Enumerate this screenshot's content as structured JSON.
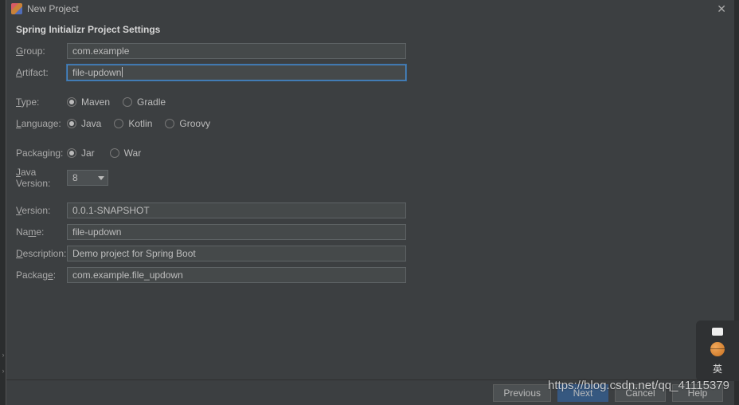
{
  "window": {
    "title": "New Project",
    "subtitle": "Spring Initializr Project Settings"
  },
  "fields": {
    "group": {
      "label": "Group:",
      "value": "com.example"
    },
    "artifact": {
      "label": "Artifact:",
      "value": "file-updown"
    },
    "type": {
      "label": "Type:",
      "options": [
        "Maven",
        "Gradle"
      ],
      "selected": "Maven"
    },
    "language": {
      "label": "Language:",
      "options": [
        "Java",
        "Kotlin",
        "Groovy"
      ],
      "selected": "Java"
    },
    "packaging": {
      "label": "Packaging:",
      "options": [
        "Jar",
        "War"
      ],
      "selected": "Jar"
    },
    "java_version": {
      "label": "Java Version:",
      "value": "8"
    },
    "version": {
      "label": "Version:",
      "value": "0.0.1-SNAPSHOT"
    },
    "name": {
      "label": "Name:",
      "value": "file-updown"
    },
    "description": {
      "label": "Description:",
      "value": "Demo project for Spring Boot"
    },
    "package": {
      "label": "Package:",
      "value": "com.example.file_updown"
    }
  },
  "footer": {
    "previous": "Previous",
    "next": "Next",
    "cancel": "Cancel",
    "help": "Help"
  },
  "watermark": "https://blog.csdn.net/qq_41115379",
  "ime": "英"
}
